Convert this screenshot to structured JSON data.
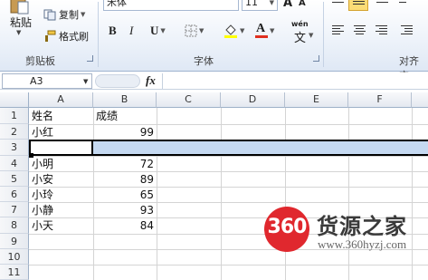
{
  "ribbon": {
    "clipboard": {
      "paste_label": "粘贴",
      "copy_label": "复制",
      "format_painter_label": "格式刷",
      "group_label": "剪贴板"
    },
    "font": {
      "font_name": "宋体",
      "font_size": "11",
      "bold_label": "B",
      "italic_label": "I",
      "underline_label": "U",
      "grow_label": "A",
      "shrink_label": "A",
      "phonetic_label": "wén",
      "phonetic_char": "文",
      "font_color_label": "A",
      "group_label": "字体",
      "fill_color": "#ffff00",
      "font_color": "#e03020"
    },
    "alignment": {
      "group_label": "对齐方"
    }
  },
  "formula_bar": {
    "name_box": "A3",
    "fx_label": "fx",
    "formula": ""
  },
  "grid": {
    "columns": [
      "A",
      "B",
      "C",
      "D",
      "E",
      "F"
    ],
    "rows": [
      "1",
      "2",
      "3",
      "4",
      "5",
      "6",
      "7",
      "8",
      "9",
      "10",
      "11"
    ],
    "cells": {
      "A1": "姓名",
      "B1": "成绩",
      "A2": "小红",
      "B2": "99",
      "A4": "小明",
      "B4": "72",
      "A5": "小安",
      "B5": "89",
      "A6": "小玲",
      "B6": "65",
      "A7": "小静",
      "B7": "93",
      "A8": "小天",
      "B8": "84"
    },
    "selected_row": "3",
    "selection_color": "#c5d9f1"
  },
  "watermark": {
    "logo_number": "360",
    "name": "货源之家",
    "url": "www.360hyzj.com",
    "logo_color": "#e0282e"
  }
}
